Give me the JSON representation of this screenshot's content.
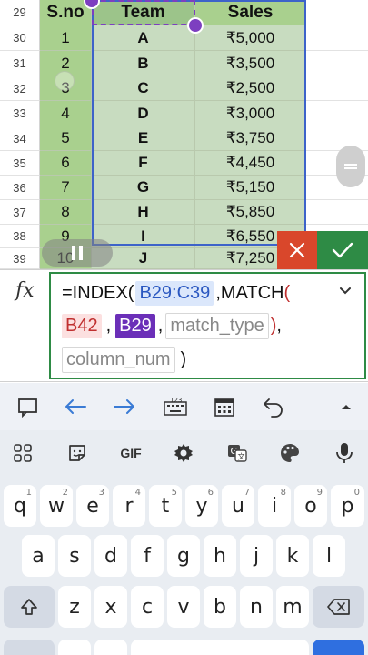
{
  "sheet": {
    "header": {
      "row": "29",
      "a": "S.no",
      "b": "Team",
      "c": "Sales"
    },
    "rows": [
      {
        "row": "30",
        "a": "1",
        "b": "A",
        "c": "₹5,000"
      },
      {
        "row": "31",
        "a": "2",
        "b": "B",
        "c": "₹3,500"
      },
      {
        "row": "32",
        "a": "3",
        "b": "C",
        "c": "₹2,500"
      },
      {
        "row": "33",
        "a": "4",
        "b": "D",
        "c": "₹3,000"
      },
      {
        "row": "34",
        "a": "5",
        "b": "E",
        "c": "₹3,750"
      },
      {
        "row": "35",
        "a": "6",
        "b": "F",
        "c": "₹4,450"
      },
      {
        "row": "36",
        "a": "7",
        "b": "G",
        "c": "₹5,150"
      },
      {
        "row": "37",
        "a": "8",
        "b": "H",
        "c": "₹5,850"
      },
      {
        "row": "38",
        "a": "9",
        "b": "I",
        "c": "₹6,550"
      },
      {
        "row": "39",
        "a": "10",
        "b": "J",
        "c": "₹7,250"
      }
    ],
    "colors": {
      "sno_fill": "#a9d08e",
      "table_fill": "#c8dcc0",
      "range_border": "#3d63c9",
      "copy_border": "#7d3fc0"
    }
  },
  "formula_bar": {
    "fx_label": "fx",
    "line1": {
      "prefix": "=INDEX(",
      "range": "B29:C39",
      "match": ",MATCH",
      "paren": "("
    },
    "line2": {
      "lookup": "B42",
      "sep1": ",",
      "array": "B29",
      "sep2": ",",
      "hint": "match_type",
      "close": ")",
      "comma": ","
    },
    "line3": {
      "hint": "column_num",
      "close": ")"
    }
  },
  "toolbar": {
    "icons": [
      "comment-icon",
      "arrow-left-icon",
      "arrow-right-icon",
      "numeric-keyboard-icon",
      "calendar-icon",
      "undo-icon",
      "expand-up-icon"
    ]
  },
  "keyboard": {
    "suggestion_gif": "GIF",
    "row1": [
      {
        "k": "q",
        "h": "1"
      },
      {
        "k": "w",
        "h": "2"
      },
      {
        "k": "e",
        "h": "3"
      },
      {
        "k": "r",
        "h": "4"
      },
      {
        "k": "t",
        "h": "5"
      },
      {
        "k": "y",
        "h": "6"
      },
      {
        "k": "u",
        "h": "7"
      },
      {
        "k": "i",
        "h": "8"
      },
      {
        "k": "o",
        "h": "9"
      },
      {
        "k": "p",
        "h": "0"
      }
    ],
    "row2": [
      "a",
      "s",
      "d",
      "f",
      "g",
      "h",
      "j",
      "k",
      "l"
    ],
    "row3": [
      "z",
      "x",
      "c",
      "v",
      "b",
      "n",
      "m"
    ]
  }
}
